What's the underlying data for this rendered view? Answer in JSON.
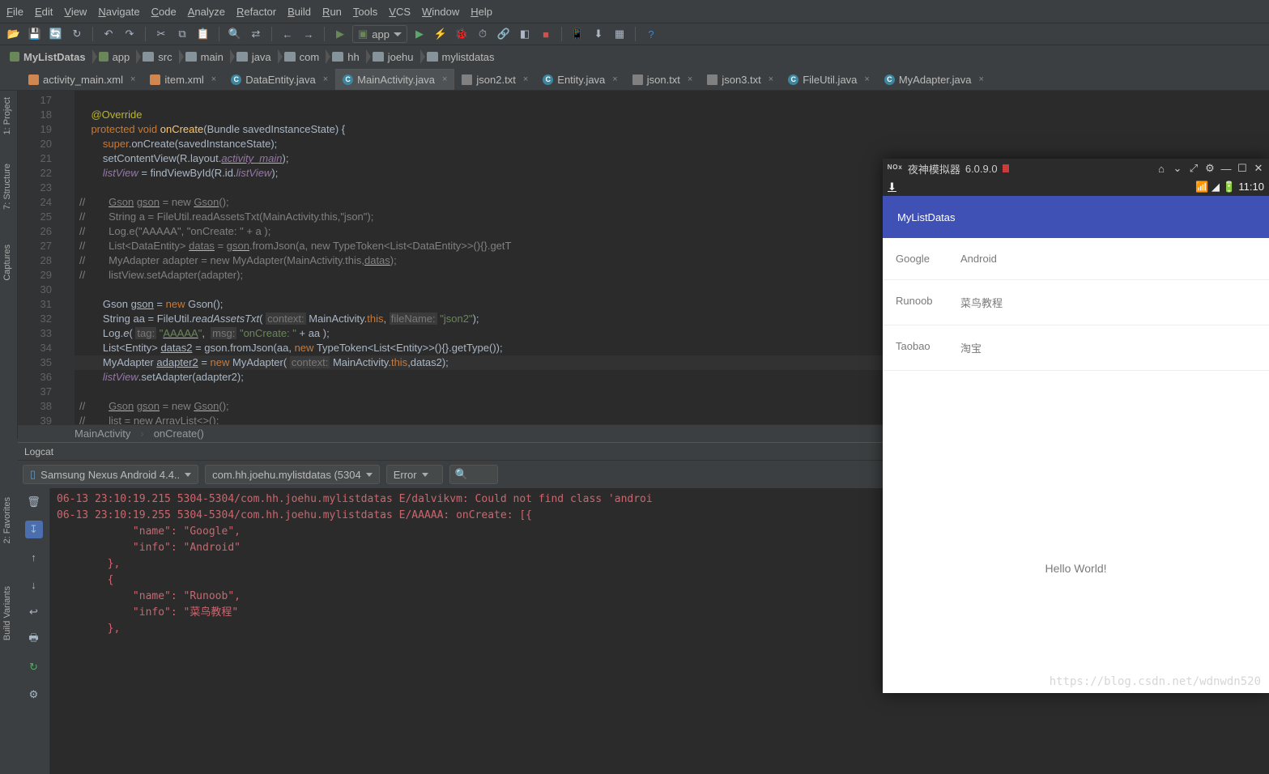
{
  "menus": [
    "File",
    "Edit",
    "View",
    "Navigate",
    "Code",
    "Analyze",
    "Refactor",
    "Build",
    "Run",
    "Tools",
    "VCS",
    "Window",
    "Help"
  ],
  "run_config": {
    "label": "app"
  },
  "crumbs": [
    "MyListDatas",
    "app",
    "src",
    "main",
    "java",
    "com",
    "hh",
    "joehu",
    "mylistdatas"
  ],
  "tabs": [
    {
      "label": "activity_main.xml",
      "icon": "xml"
    },
    {
      "label": "item.xml",
      "icon": "xml"
    },
    {
      "label": "DataEntity.java",
      "icon": "c"
    },
    {
      "label": "MainActivity.java",
      "icon": "c",
      "active": true
    },
    {
      "label": "json2.txt",
      "icon": "txt"
    },
    {
      "label": "Entity.java",
      "icon": "c"
    },
    {
      "label": "json.txt",
      "icon": "txt"
    },
    {
      "label": "json3.txt",
      "icon": "txt"
    },
    {
      "label": "FileUtil.java",
      "icon": "c"
    },
    {
      "label": "MyAdapter.java",
      "icon": "c"
    }
  ],
  "line_start": 17,
  "line_end": 39,
  "code_crumbs": [
    "MainActivity",
    "onCreate()"
  ],
  "side_tabs": {
    "project": "1: Project",
    "structure": "7: Structure",
    "captures": "Captures",
    "favorites": "2: Favorites",
    "build": "Build Variants"
  },
  "logcat": {
    "title": "Logcat",
    "device": "Samsung Nexus Android 4.4..",
    "process": "com.hh.joehu.mylistdatas (5304",
    "level": "Error",
    "search_placeholder": "Q▾",
    "lines": [
      "06-13 23:10:19.215 5304-5304/com.hh.joehu.mylistdatas E/dalvikvm: Could not find class 'androi",
      "06-13 23:10:19.255 5304-5304/com.hh.joehu.mylistdatas E/AAAAA: onCreate: [{",
      "            \"name\": \"Google\",",
      "            \"info\": \"Android\"",
      "        },",
      "        {",
      "            \"name\": \"Runoob\",",
      "            \"info\": \"菜鸟教程\"",
      "        },"
    ]
  },
  "emulator": {
    "title_prefix": "夜神模拟器",
    "version": "6.0.9.0",
    "clock": "11:10",
    "app_title": "MyListDatas",
    "rows": [
      {
        "name": "Google",
        "info": "Android"
      },
      {
        "name": "Runoob",
        "info": "菜鸟教程"
      },
      {
        "name": "Taobao",
        "info": "淘宝"
      }
    ],
    "hello": "Hello World!"
  },
  "watermark": "https://blog.csdn.net/wdnwdn520"
}
